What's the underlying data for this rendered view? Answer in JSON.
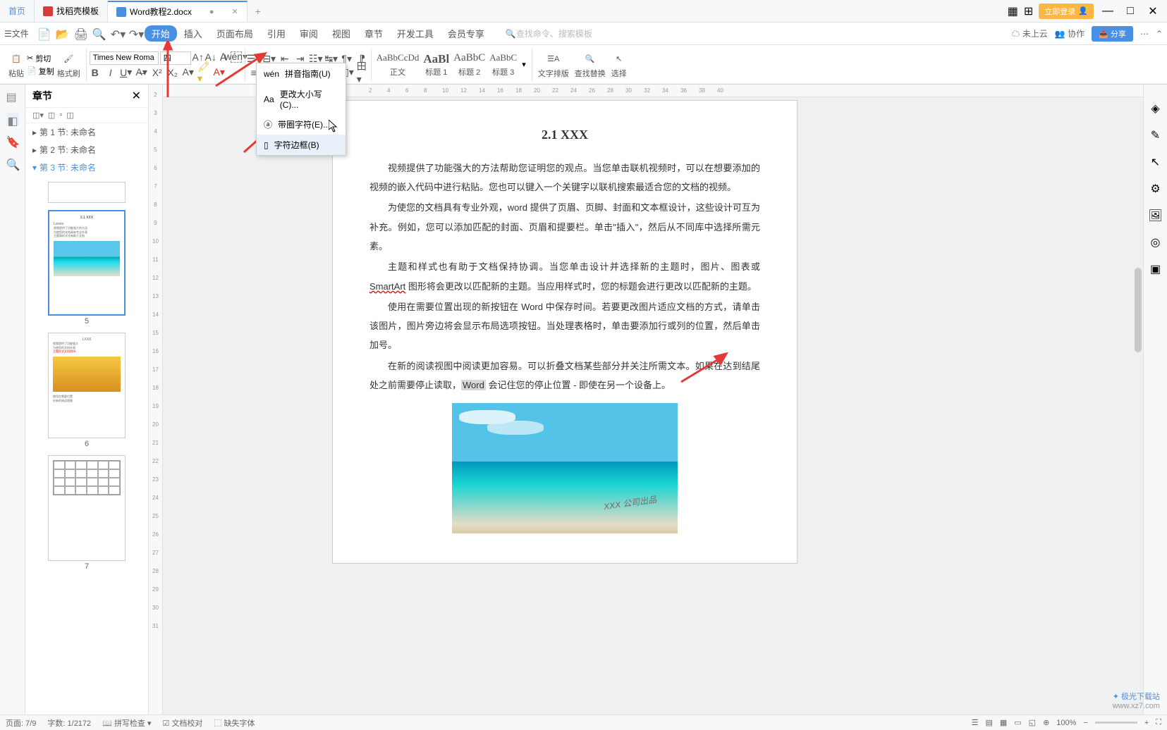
{
  "titlebar": {
    "home_tab": "首页",
    "template_tab": "找稻壳模板",
    "doc_tab": "Word教程2.docx",
    "login": "立即登录"
  },
  "menubar": {
    "file": "文件",
    "tabs": [
      "开始",
      "插入",
      "页面布局",
      "引用",
      "审阅",
      "视图",
      "章节",
      "开发工具",
      "会员专享"
    ],
    "search_placeholder": "查找命令、搜索模板",
    "cloud": "未上云",
    "coop": "协作",
    "share": "分享"
  },
  "toolbar": {
    "paste": "粘贴",
    "cut": "剪切",
    "copy": "复制",
    "format_painter": "格式刷",
    "font_name": "Times New Roma",
    "font_size": "四",
    "styles": {
      "normal": {
        "prev": "AaBbCcDd",
        "label": "正文"
      },
      "h1": {
        "prev": "AaBl",
        "label": "标题 1"
      },
      "h2": {
        "prev": "AaBbC",
        "label": "标题 2"
      },
      "h3": {
        "prev": "AaBbC",
        "label": "标题 3"
      }
    },
    "text_layout": "文字排版",
    "find_replace": "查找替换",
    "select": "选择"
  },
  "dropdown": {
    "i1": "拼音指南(U)",
    "i2": "更改大小写(C)...",
    "i3": "带圈字符(E)...",
    "i4": "字符边框(B)"
  },
  "nav": {
    "title": "章节",
    "sec1": "第 1 节: 未命名",
    "sec2": "第 2 节: 未命名",
    "sec3": "第 3 节: 未命名",
    "p5": "5",
    "p6": "6",
    "p7": "7"
  },
  "doc": {
    "title": "2.1 XXX",
    "p1a": "视频提供了功能强大的方法帮助您证明您的观点。当您单击联机视频时，可以在想要添加的视频的嵌入代码中进行粘贴。您也可以键入一个关键字以联机搜索最适合您的文档的视频。",
    "p2": "为使您的文档具有专业外观，word 提供了页眉、页脚、封面和文本框设计，这些设计可互为补充。例如，您可以添加匹配的封面、页眉和提要栏。单击\"插入\"，然后从不同库中选择所需元素。",
    "p3a": "主题和样式也有助于文档保持协调。当您单击设计并选择新的主题时，图片、图表或 ",
    "p3_smart": "SmartArt",
    "p3b": " 图形将会更改以匹配新的主题。当应用样式时，您的标题会进行更改以匹配新的主题。",
    "p4": "使用在需要位置出现的新按钮在 Word 中保存时间。若要更改图片适应文档的方式，请单击该图片，图片旁边将会显示布局选项按钮。当处理表格时，单击要添加行或列的位置，然后单击加号。",
    "p5a": "在新的阅读视图中阅读更加容易。可以折叠文档某些部分并关注所需文本。如果在达到结尾处之前需要停止读取，",
    "p5_word": "Word",
    "p5b": " 会记住您的停止位置 - 即使在另一个设备上。",
    "watermark": "XXX 公司出品"
  },
  "statusbar": {
    "page": "页面: 7/9",
    "words": "字数: 1/2172",
    "spell": "拼写检查",
    "proof": "文档校对",
    "missing_font": "缺失字体",
    "zoom": "100%"
  },
  "footer_logo": {
    "brand": "极光下载站",
    "url": "www.xz7.com"
  }
}
